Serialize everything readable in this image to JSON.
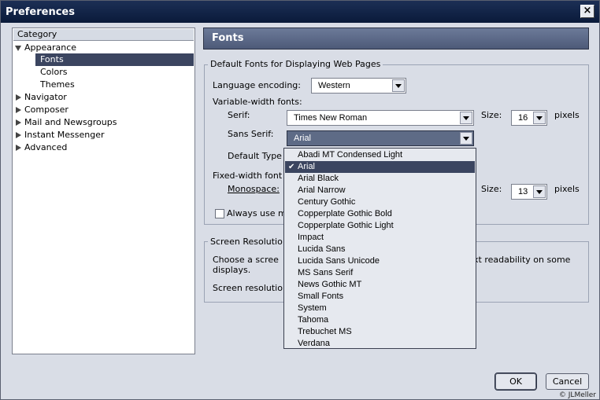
{
  "window": {
    "title": "Preferences",
    "close_glyph": "×"
  },
  "tree": {
    "header": "Category",
    "items": [
      {
        "label": "Appearance",
        "twisty": "down"
      },
      {
        "label": "Fonts"
      },
      {
        "label": "Colors"
      },
      {
        "label": "Themes"
      },
      {
        "label": "Navigator",
        "twisty": "right"
      },
      {
        "label": "Composer",
        "twisty": "right"
      },
      {
        "label": "Mail and Newsgroups",
        "twisty": "right"
      },
      {
        "label": "Instant Messenger",
        "twisty": "right"
      },
      {
        "label": "Advanced",
        "twisty": "right"
      }
    ]
  },
  "panel": {
    "header": "Fonts",
    "fonts_group": "Default Fonts for Displaying Web Pages",
    "language_encoding_label": "Language encoding:",
    "language_encoding_value": "Western",
    "variable_width_label": "Variable-width fonts:",
    "serif_label": "Serif:",
    "serif_value": "Times New Roman",
    "size_label": "Size:",
    "serif_size": "16",
    "pixels_label": "pixels",
    "sans_serif_label": "Sans Serif:",
    "sans_serif_value": "Arial",
    "default_type_label": "Default Type",
    "fixed_width_label": "Fixed-width font",
    "monospace_label": "Monospace:",
    "mono_size": "13",
    "always_use_label": "Always use m",
    "screen_group": "Screen Resolutio",
    "screen_text_1": "Choose a scree",
    "screen_text_1_right": "xt readability on some",
    "screen_text_2": "displays.",
    "screen_resolution_label": "Screen resolutio"
  },
  "dropdown": {
    "items": [
      "Abadi MT Condensed Light",
      "Arial",
      "Arial Black",
      "Arial Narrow",
      "Century Gothic",
      "Copperplate Gothic Bold",
      "Copperplate Gothic Light",
      "Impact",
      "Lucida Sans",
      "Lucida Sans Unicode",
      "MS Sans Serif",
      "News Gothic MT",
      "Small Fonts",
      "System",
      "Tahoma",
      "Trebuchet MS",
      "Verdana"
    ],
    "selected": "Arial",
    "check_glyph": "✔"
  },
  "buttons": {
    "ok": "OK",
    "cancel": "Cancel"
  },
  "copyright": "© JLMeller"
}
